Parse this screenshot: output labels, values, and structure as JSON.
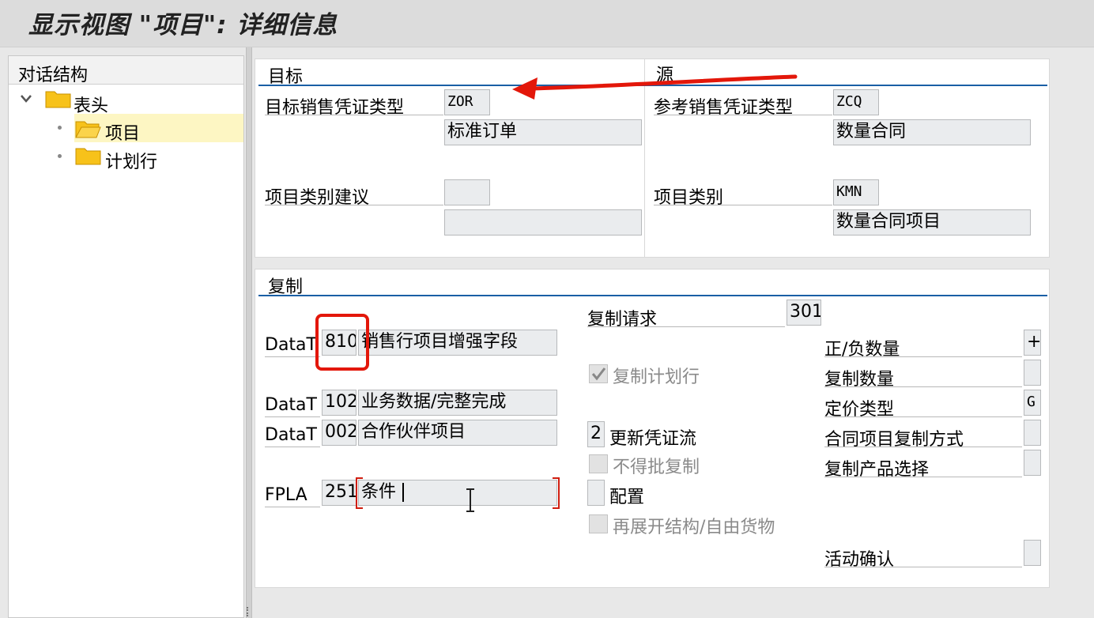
{
  "window": {
    "title": "显示视图 \"项目\": 详细信息"
  },
  "tree": {
    "header": "对话结构",
    "items": [
      {
        "label": "表头"
      },
      {
        "label": "项目"
      },
      {
        "label": "计划行"
      }
    ]
  },
  "target": {
    "title": "目标",
    "doc_type_label": "目标销售凭证类型",
    "doc_type_value": "ZOR",
    "doc_type_desc": "标准订单",
    "item_cat_label": "项目类别建议",
    "item_cat_value": "",
    "item_cat_desc": ""
  },
  "source": {
    "title": "源",
    "doc_type_label": "参考销售凭证类型",
    "doc_type_value": "ZCQ",
    "doc_type_desc": "数量合同",
    "item_cat_label": "项目类别",
    "item_cat_value": "KMN",
    "item_cat_desc": "数量合同项目"
  },
  "copy": {
    "title": "复制",
    "rows": [
      {
        "label": "DataT",
        "code": "810",
        "desc": "销售行项目增强字段"
      },
      {
        "label": "DataT",
        "code": "102",
        "desc": "业务数据/完整完成"
      },
      {
        "label": "DataT",
        "code": "002",
        "desc": "合作伙伴项目"
      },
      {
        "label": "FPLA",
        "code": "251",
        "desc": "条件"
      }
    ],
    "copy_req_label": "复制请求",
    "copy_req_value": "301",
    "copy_sched_label": "复制计划行",
    "copy_sched_checked": true,
    "update_flow_value": "2",
    "update_flow_label": "更新凭证流",
    "no_batch_label": "不得批复制",
    "config_label": "配置",
    "reexplode_label": "再展开结构/自由货物",
    "pos_neg_label": "正/负数量",
    "pos_neg_value": "+",
    "copy_qty_label": "复制数量",
    "copy_qty_value": "",
    "pricing_type_label": "定价类型",
    "pricing_type_value": "G",
    "contract_copy_label": "合同项目复制方式",
    "contract_copy_value": "",
    "copy_prod_sel_label": "复制产品选择",
    "copy_prod_sel_value": "",
    "active_confirm_label": "活动确认",
    "active_confirm_value": ""
  },
  "annotation_color": "#e3170a"
}
